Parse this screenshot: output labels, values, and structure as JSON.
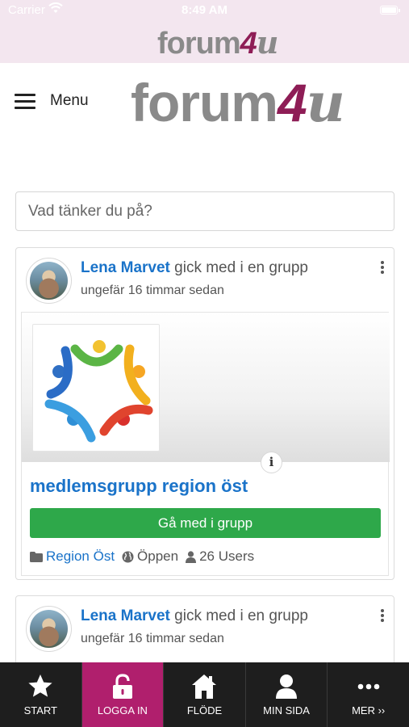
{
  "status_bar": {
    "carrier": "Carrier",
    "time": "8:49 AM"
  },
  "brand": {
    "part1": "forum",
    "part2": "4",
    "part3": "u"
  },
  "header": {
    "menu_label": "Menu"
  },
  "composer": {
    "placeholder": "Vad tänker du på?"
  },
  "feed": [
    {
      "author": "Lena Marvet",
      "action": " gick med i en grupp",
      "time": "ungefär 16 timmar sedan",
      "group": {
        "name": "medlemsgrupp region öst",
        "join_label": "Gå med i grupp",
        "category": "Region Öst",
        "privacy": "Öppen",
        "members": "26 Users"
      }
    },
    {
      "author": "Lena Marvet",
      "action": " gick med i en grupp",
      "time": "ungefär 16 timmar sedan"
    }
  ],
  "tabbar": {
    "items": [
      {
        "label": "START",
        "icon": "star-icon"
      },
      {
        "label": "LOGGA IN",
        "icon": "lock-icon",
        "active": true
      },
      {
        "label": "FLÖDE",
        "icon": "home-icon"
      },
      {
        "label": "MIN SIDA",
        "icon": "user-icon"
      },
      {
        "label": "MER ››",
        "icon": "more-icon"
      }
    ]
  },
  "colors": {
    "accent": "#b01f6d",
    "link": "#1a73c9",
    "join_button": "#2ea84a",
    "brand_bar": "#f3e6ef"
  }
}
